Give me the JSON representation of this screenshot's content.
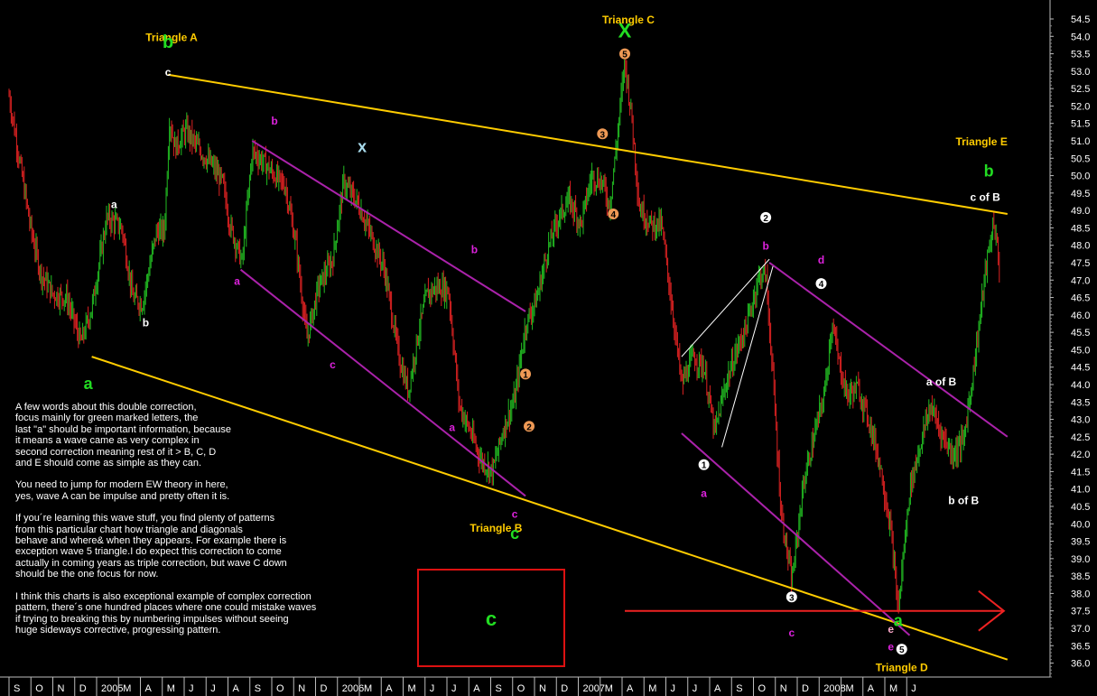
{
  "chart_data": {
    "type": "line",
    "title": "",
    "xlabel": "",
    "ylabel": "",
    "ylim": [
      35.75,
      54.85
    ],
    "y_ticks": [
      "54.5",
      "54.0",
      "53.5",
      "53.0",
      "52.5",
      "52.0",
      "51.5",
      "51.0",
      "50.5",
      "50.0",
      "49.5",
      "49.0",
      "48.5",
      "48.0",
      "47.5",
      "47.0",
      "46.5",
      "46.0",
      "45.5",
      "45.0",
      "44.5",
      "44.0",
      "43.5",
      "43.0",
      "42.5",
      "42.0",
      "41.5",
      "41.0",
      "40.5",
      "40.0",
      "39.5",
      "39.0",
      "38.5",
      "38.0",
      "37.5",
      "37.0",
      "36.5",
      "36.0"
    ],
    "x_ticks": [
      "S",
      "O",
      "N",
      "D",
      "2005",
      "M",
      "A",
      "M",
      "J",
      "J",
      "A",
      "S",
      "O",
      "N",
      "D",
      "2006",
      "M",
      "A",
      "M",
      "J",
      "J",
      "A",
      "S",
      "O",
      "N",
      "D",
      "2007",
      "M",
      "A",
      "M",
      "J",
      "J",
      "A",
      "S",
      "O",
      "N",
      "D",
      "2008",
      "M",
      "A",
      "M",
      "J"
    ],
    "x_range": [
      "2004-09",
      "2008-06"
    ],
    "series": [
      {
        "type": "ohlc-bars",
        "color": "#22bb22",
        "down_color": "#dd2222",
        "points": [
          [
            "2004-09-01",
            52.3
          ],
          [
            "2004-09-15",
            50.5
          ],
          [
            "2004-10-01",
            48.5
          ],
          [
            "2004-10-15",
            47.2
          ],
          [
            "2004-11-01",
            46.6
          ],
          [
            "2004-11-20",
            46.5
          ],
          [
            "2004-12-10",
            45.2
          ],
          [
            "2004-12-25",
            46.2
          ],
          [
            "2005-01-15",
            48.8
          ],
          [
            "2005-02-05",
            48.5
          ],
          [
            "2005-02-20",
            46.5
          ],
          [
            "2005-03-05",
            46.3
          ],
          [
            "2005-03-25",
            48.4
          ],
          [
            "2005-04-05",
            48.4
          ],
          [
            "2005-04-12",
            51.6
          ],
          [
            "2005-04-20",
            50.8
          ],
          [
            "2005-05-05",
            51.3
          ],
          [
            "2005-05-25",
            50.7
          ],
          [
            "2005-06-10",
            50.3
          ],
          [
            "2005-06-25",
            49.8
          ],
          [
            "2005-07-05",
            48.6
          ],
          [
            "2005-07-22",
            47.5
          ],
          [
            "2005-08-05",
            50.7
          ],
          [
            "2005-08-20",
            50.4
          ],
          [
            "2005-09-05",
            50.0
          ],
          [
            "2005-09-20",
            49.7
          ],
          [
            "2005-10-05",
            48.0
          ],
          [
            "2005-10-20",
            45.3
          ],
          [
            "2005-11-05",
            46.8
          ],
          [
            "2005-11-25",
            47.6
          ],
          [
            "2005-12-10",
            49.8
          ],
          [
            "2005-12-30",
            49.2
          ],
          [
            "2006-01-15",
            48.4
          ],
          [
            "2006-02-05",
            47.3
          ],
          [
            "2006-02-25",
            44.8
          ],
          [
            "2006-03-10",
            43.8
          ],
          [
            "2006-03-25",
            45.6
          ],
          [
            "2006-04-05",
            46.6
          ],
          [
            "2006-04-20",
            46.8
          ],
          [
            "2006-05-05",
            46.7
          ],
          [
            "2006-05-20",
            43.4
          ],
          [
            "2006-06-05",
            42.6
          ],
          [
            "2006-06-20",
            41.8
          ],
          [
            "2006-07-05",
            41.5
          ],
          [
            "2006-07-20",
            42.7
          ],
          [
            "2006-08-05",
            43.6
          ],
          [
            "2006-08-20",
            45.7
          ],
          [
            "2006-09-05",
            46.5
          ],
          [
            "2006-09-20",
            47.9
          ],
          [
            "2006-10-05",
            48.8
          ],
          [
            "2006-10-20",
            49.3
          ],
          [
            "2006-11-05",
            48.6
          ],
          [
            "2006-11-20",
            50.0
          ],
          [
            "2006-12-05",
            49.8
          ],
          [
            "2006-12-15",
            49.1
          ],
          [
            "2006-12-25",
            51.0
          ],
          [
            "2007-01-05",
            53.3
          ],
          [
            "2007-01-15",
            51.6
          ],
          [
            "2007-01-25",
            49.1
          ],
          [
            "2007-02-10",
            48.6
          ],
          [
            "2007-02-25",
            48.6
          ],
          [
            "2007-03-10",
            46.5
          ],
          [
            "2007-03-25",
            44.0
          ],
          [
            "2007-04-10",
            44.8
          ],
          [
            "2007-04-25",
            44.5
          ],
          [
            "2007-05-10",
            42.6
          ],
          [
            "2007-05-25",
            44.0
          ],
          [
            "2007-06-10",
            45.0
          ],
          [
            "2007-06-25",
            45.8
          ],
          [
            "2007-07-10",
            47.1
          ],
          [
            "2007-07-20",
            47.2
          ],
          [
            "2007-07-30",
            44.2
          ],
          [
            "2007-08-10",
            40.4
          ],
          [
            "2007-08-25",
            38.3
          ],
          [
            "2007-09-10",
            41.1
          ],
          [
            "2007-09-25",
            42.5
          ],
          [
            "2007-10-10",
            43.8
          ],
          [
            "2007-10-20",
            45.8
          ],
          [
            "2007-10-30",
            44.6
          ],
          [
            "2007-11-10",
            43.7
          ],
          [
            "2007-11-25",
            43.9
          ],
          [
            "2007-12-10",
            43.0
          ],
          [
            "2007-12-25",
            41.8
          ],
          [
            "2008-01-10",
            39.8
          ],
          [
            "2008-01-20",
            37.5
          ],
          [
            "2008-02-05",
            41.0
          ],
          [
            "2008-02-20",
            42.3
          ],
          [
            "2008-03-05",
            43.4
          ],
          [
            "2008-03-20",
            42.6
          ],
          [
            "2008-04-05",
            42.0
          ],
          [
            "2008-04-20",
            42.4
          ],
          [
            "2008-05-05",
            44.6
          ],
          [
            "2008-05-20",
            47.2
          ],
          [
            "2008-06-01",
            48.7
          ],
          [
            "2008-06-10",
            47.2
          ]
        ]
      }
    ],
    "trendlines": [
      {
        "color": "#ffcc00",
        "from": [
          "2005-04-10",
          52.9
        ],
        "to": [
          "2008-06-20",
          48.9
        ]
      },
      {
        "color": "#ffcc00",
        "from": [
          "2004-12-25",
          44.8
        ],
        "to": [
          "2008-06-20",
          36.1
        ]
      },
      {
        "color": "#aa22aa",
        "from": [
          "2005-08-05",
          51.0
        ],
        "to": [
          "2006-08-20",
          46.1
        ]
      },
      {
        "color": "#aa22aa",
        "from": [
          "2005-07-20",
          47.3
        ],
        "to": [
          "2006-08-20",
          40.8
        ]
      },
      {
        "color": "#aa22aa",
        "from": [
          "2007-07-25",
          47.5
        ],
        "to": [
          "2008-06-20",
          42.5
        ]
      },
      {
        "color": "#aa22aa",
        "from": [
          "2007-03-25",
          42.6
        ],
        "to": [
          "2008-02-05",
          36.8
        ]
      },
      {
        "color": "#ffffff",
        "from": [
          "2007-03-25",
          44.8
        ],
        "to": [
          "2007-07-25",
          47.6
        ]
      },
      {
        "color": "#ffffff",
        "from": [
          "2007-05-20",
          42.2
        ],
        "to": [
          "2007-07-30",
          47.4
        ]
      },
      {
        "color": "#ee2222",
        "from": [
          "2007-01-05",
          37.5
        ],
        "to": [
          "2008-06-15",
          37.5
        ],
        "arrow": true
      }
    ],
    "annotations": [
      {
        "text": "Triangle A",
        "color": "#ffcc00",
        "x": "2005-04-15",
        "y": 54.0
      },
      {
        "text": "b",
        "color": "#22dd22",
        "x": "2005-04-10",
        "y": 53.8,
        "size": 20
      },
      {
        "text": "c",
        "color": "#ffffff",
        "x": "2005-04-10",
        "y": 53.0
      },
      {
        "text": "a",
        "color": "#ffffff",
        "x": "2005-01-25",
        "y": 49.2
      },
      {
        "text": "b",
        "color": "#ffffff",
        "x": "2005-03-10",
        "y": 45.8
      },
      {
        "text": "a",
        "color": "#22dd22",
        "x": "2004-12-20",
        "y": 44.0,
        "size": 18
      },
      {
        "text": "b",
        "color": "#dd22dd",
        "x": "2005-09-05",
        "y": 51.6
      },
      {
        "text": "a",
        "color": "#dd22dd",
        "x": "2005-07-15",
        "y": 47.0
      },
      {
        "text": "c",
        "color": "#dd22dd",
        "x": "2005-11-25",
        "y": 44.6
      },
      {
        "text": "x",
        "color": "#aaddee",
        "x": "2006-01-05",
        "y": 50.8,
        "size": 18
      },
      {
        "text": "b",
        "color": "#dd22dd",
        "x": "2006-06-10",
        "y": 47.9
      },
      {
        "text": "a",
        "color": "#dd22dd",
        "x": "2006-05-10",
        "y": 42.8
      },
      {
        "text": "c",
        "color": "#dd22dd",
        "x": "2006-08-05",
        "y": 40.3
      },
      {
        "text": "Triangle B",
        "color": "#ffcc00",
        "x": "2006-07-10",
        "y": 39.9
      },
      {
        "text": "c",
        "color": "#22dd22",
        "x": "2006-08-05",
        "y": 39.7,
        "size": 18
      },
      {
        "text": "1",
        "color": "#ee9955",
        "x": "2006-08-20",
        "y": 44.3,
        "circle": true
      },
      {
        "text": "2",
        "color": "#ee9955",
        "x": "2006-08-25",
        "y": 42.8,
        "circle": true
      },
      {
        "text": "3",
        "color": "#ee9955",
        "x": "2006-12-05",
        "y": 51.2,
        "circle": true
      },
      {
        "text": "4",
        "color": "#ee9955",
        "x": "2006-12-20",
        "y": 48.9,
        "circle": true
      },
      {
        "text": "5",
        "color": "#ee9955",
        "x": "2007-01-05",
        "y": 53.5,
        "circle": true
      },
      {
        "text": "Triangle C",
        "color": "#ffcc00",
        "x": "2007-01-10",
        "y": 54.5
      },
      {
        "text": "X",
        "color": "#22dd22",
        "x": "2007-01-05",
        "y": 54.1,
        "size": 22
      },
      {
        "text": "2",
        "color": "#ffffff",
        "x": "2007-07-20",
        "y": 48.8,
        "circle": true
      },
      {
        "text": "b",
        "color": "#dd22dd",
        "x": "2007-07-20",
        "y": 48.0
      },
      {
        "text": "1",
        "color": "#ffffff",
        "x": "2007-04-25",
        "y": 41.7,
        "circle": true
      },
      {
        "text": "a",
        "color": "#dd22dd",
        "x": "2007-04-25",
        "y": 40.9
      },
      {
        "text": "3",
        "color": "#ffffff",
        "x": "2007-08-25",
        "y": 37.9,
        "circle": true
      },
      {
        "text": "c",
        "color": "#dd22dd",
        "x": "2007-08-25",
        "y": 36.9
      },
      {
        "text": "d",
        "color": "#dd22dd",
        "x": "2007-10-05",
        "y": 47.6
      },
      {
        "text": "4",
        "color": "#ffffff",
        "x": "2007-10-05",
        "y": 46.9,
        "circle": true
      },
      {
        "text": "e",
        "color": "#ffaacc",
        "x": "2008-01-10",
        "y": 37.0
      },
      {
        "text": "e",
        "color": "#dd22dd",
        "x": "2008-01-10",
        "y": 36.5
      },
      {
        "text": "a",
        "color": "#22dd22",
        "x": "2008-01-20",
        "y": 37.2,
        "size": 18
      },
      {
        "text": "5",
        "color": "#ffffff",
        "x": "2008-01-25",
        "y": 36.4,
        "circle": true
      },
      {
        "text": "Triangle D",
        "color": "#ffcc00",
        "x": "2008-01-25",
        "y": 35.9
      },
      {
        "text": "a of B",
        "color": "#ffffff",
        "x": "2008-03-20",
        "y": 44.1
      },
      {
        "text": "b of B",
        "color": "#ffffff",
        "x": "2008-04-20",
        "y": 40.7
      },
      {
        "text": "Triangle E",
        "color": "#ffcc00",
        "x": "2008-05-15",
        "y": 51.0
      },
      {
        "text": "b",
        "color": "#22dd22",
        "x": "2008-05-25",
        "y": 50.1,
        "size": 18
      },
      {
        "text": "c of B",
        "color": "#ffffff",
        "x": "2008-05-20",
        "y": 49.4
      }
    ],
    "box_label": "c"
  },
  "notes": [
    "A few words about this double correction,\nfocus mainly for green marked letters, the\nlast \"a\" should be important information, because\nit means a wave came as very complex in\nsecond correction meaning rest of it > B, C, D\nand E should come as simple as they can.",
    "You need to jump for modern EW theory in here,\nyes, wave A can be impulse and pretty often it is.",
    "If you´re learning this wave stuff, you find plenty of patterns\nfrom this particular chart how triangle and diagonals\nbehave and where& when  they appears. For example there is\nexception wave 5 triangle.I do expect this correction to come\nactually in coming years as triple correction, but wave C down\nshould be the one focus for now.",
    "I think this charts is also exceptional example of complex correction\npattern, there´s one hundred places where one could mistake waves\nif trying to breaking this by numbering impulses without seeing\nhuge sideways corrective, progressing pattern."
  ]
}
